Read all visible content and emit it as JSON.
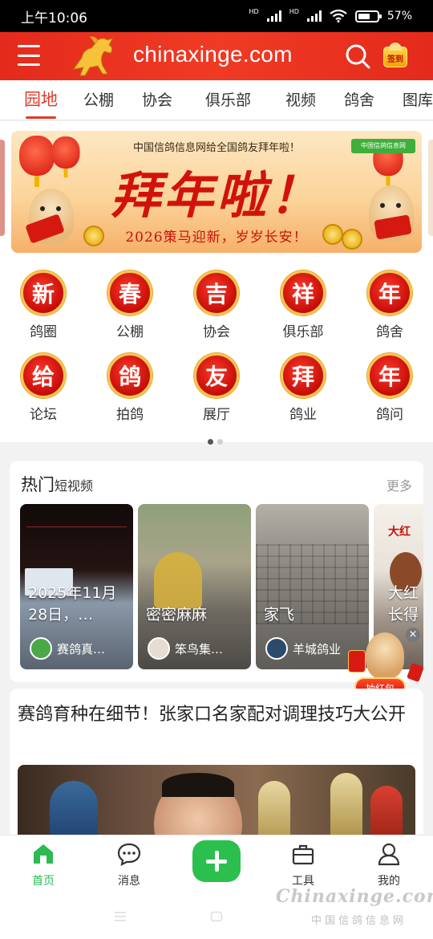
{
  "status_bar": {
    "time": "上午10:06",
    "battery": "57%"
  },
  "header": {
    "brand": "chinaxinge.com",
    "signin_label": "签到"
  },
  "tabs": [
    "园地",
    "公棚",
    "协会",
    "俱乐部",
    "视频",
    "鸽舍",
    "图库"
  ],
  "active_tab": 0,
  "banner": {
    "top_text": "中国信鸽信息网给全国鸽友拜年啦！",
    "big_text": "拜年啦！",
    "sub_text": "2026策马迎新，岁岁长安！",
    "logo_text": "中国信鸽信息网"
  },
  "icon_grid": [
    {
      "char": "新",
      "label": "鸽圈"
    },
    {
      "char": "春",
      "label": "公棚"
    },
    {
      "char": "吉",
      "label": "协会"
    },
    {
      "char": "祥",
      "label": "俱乐部"
    },
    {
      "char": "年",
      "label": "鸽舍"
    },
    {
      "char": "给",
      "label": "论坛"
    },
    {
      "char": "鸽",
      "label": "拍鸽"
    },
    {
      "char": "友",
      "label": "展厅"
    },
    {
      "char": "拜",
      "label": "鸽业"
    },
    {
      "char": "年",
      "label": "鸽问"
    }
  ],
  "hot_videos": {
    "title": "热门",
    "subtitle": "短视频",
    "more": "更多",
    "cards": [
      {
        "caption": "2025年11月28日，…",
        "author": "赛鸽真…"
      },
      {
        "caption": "密密麻麻",
        "author": "笨鸟集…"
      },
      {
        "caption": "家飞",
        "author": "羊城鸽业"
      },
      {
        "caption": "大红长得",
        "author": ""
      }
    ]
  },
  "float_promo": {
    "label": "抽红包",
    "close": "×"
  },
  "article": {
    "title": "赛鸽育种在细节！张家口名家配对调理技巧大公开"
  },
  "bottom_nav": [
    {
      "label": "首页",
      "icon": "home-icon",
      "active": true
    },
    {
      "label": "消息",
      "icon": "message-icon",
      "active": false
    },
    {
      "label": "",
      "icon": "plus-icon",
      "active": false
    },
    {
      "label": "工具",
      "icon": "toolbox-icon",
      "active": false
    },
    {
      "label": "我的",
      "icon": "user-icon",
      "active": false
    }
  ],
  "watermark": {
    "main": "Chinaxinge.com",
    "sub": "中国信鸽信息网"
  },
  "colors": {
    "brand_red": "#e42a1c",
    "accent_green": "#2bbf4e",
    "tab_active": "#e03a2b"
  }
}
